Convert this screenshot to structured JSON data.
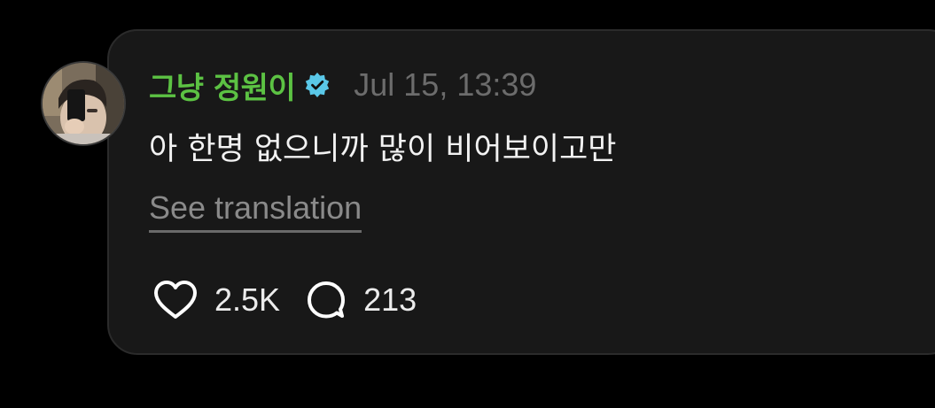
{
  "comment": {
    "username": "그냥 정원이",
    "verified": true,
    "timestamp": "Jul 15, 13:39",
    "text": "아 한명 없으니까 많이 비어보이고만",
    "translate_label": "See translation",
    "likes": "2.5K",
    "replies": "213"
  },
  "icons": {
    "avatar": "profile-photo",
    "verified": "verified-badge-icon",
    "like": "heart-icon",
    "reply": "speech-bubble-icon"
  },
  "colors": {
    "background": "#000000",
    "card": "#181818",
    "username": "#5cc243",
    "verified_badge": "#5ac8e8",
    "timestamp": "#6c6c6c",
    "text": "#f2f2f2",
    "muted": "#8a8a8a"
  }
}
